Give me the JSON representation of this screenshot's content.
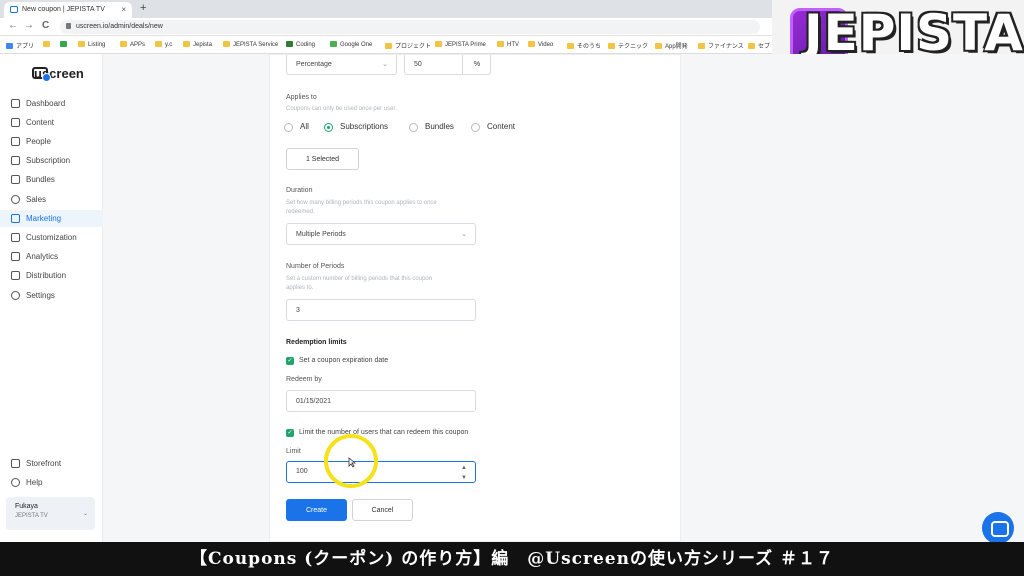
{
  "browser": {
    "tab_title": "New coupon | JEPISTA TV",
    "tab_close": "×",
    "new_tab": "+",
    "url": "uscreen.io/admin/deals/new",
    "nav": {
      "back": "←",
      "forward": "→",
      "reload": "C"
    },
    "bookmarks": [
      "アプリ",
      "Listing",
      "APPs",
      "y.c",
      "Jepista",
      "JEPISTA Service",
      "Coding",
      "Google One",
      "プロジェクト",
      "JEPISTA Prime",
      "HTV",
      "Video",
      "そのうち",
      "テクニック",
      "App開発",
      "ファイナンス",
      "セブ"
    ]
  },
  "logo": {
    "text": "JEPISTA",
    "colors": {
      "bg": "#7b22c8"
    }
  },
  "sidebar": {
    "brand": "uscreen",
    "items": [
      {
        "label": "Dashboard",
        "icon": "dashboard-icon"
      },
      {
        "label": "Content",
        "icon": "folder-icon"
      },
      {
        "label": "People",
        "icon": "people-icon"
      },
      {
        "label": "Subscription",
        "icon": "subscription-icon"
      },
      {
        "label": "Bundles",
        "icon": "bundle-icon"
      },
      {
        "label": "Sales",
        "icon": "dollar-icon"
      },
      {
        "label": "Marketing",
        "icon": "megaphone-icon"
      },
      {
        "label": "Customization",
        "icon": "edit-icon"
      },
      {
        "label": "Analytics",
        "icon": "chart-icon"
      },
      {
        "label": "Distribution",
        "icon": "distribution-icon"
      },
      {
        "label": "Settings",
        "icon": "gear-icon"
      }
    ],
    "bottom": [
      {
        "label": "Storefront",
        "icon": "storefront-icon"
      },
      {
        "label": "Help",
        "icon": "help-icon"
      }
    ],
    "user": {
      "name": "Fukaya",
      "org": "JEPISTA TV",
      "chevron": "⌄"
    }
  },
  "form": {
    "discount_type": "Percentage",
    "discount_value": "50",
    "discount_unit": "%",
    "applies_to": {
      "label": "Applies to",
      "help": "Coupons can only be used once per user.",
      "options": [
        "All",
        "Subscriptions",
        "Bundles",
        "Content"
      ],
      "selected": "Subscriptions"
    },
    "selected_button": "1 Selected",
    "duration": {
      "label": "Duration",
      "help1": "Set how many billing periods this coupon applies to once",
      "help2": "redeemed.",
      "value": "Multiple Periods"
    },
    "periods": {
      "label": "Number of Periods",
      "help1": "Set a custom number of billing periods that this coupon",
      "help2": "applies to.",
      "value": "3"
    },
    "redemption": {
      "title": "Redemption limits",
      "expiration_check": "Set a coupon expiration date",
      "redeem_by_label": "Redeem by",
      "redeem_by_value": "01/15/2021",
      "limit_check": "Limit the number of users that can redeem this coupon",
      "limit_label": "Limit",
      "limit_value": "100"
    },
    "create_button": "Create",
    "cancel_button": "Cancel"
  },
  "caption": "【Coupons (クーポン) の作り方】編　@Uscreenの使い方シリーズ ＃１７",
  "colors": {
    "accent": "#1a73e8",
    "green": "#22a36b",
    "highlight": "#f5e21a"
  }
}
